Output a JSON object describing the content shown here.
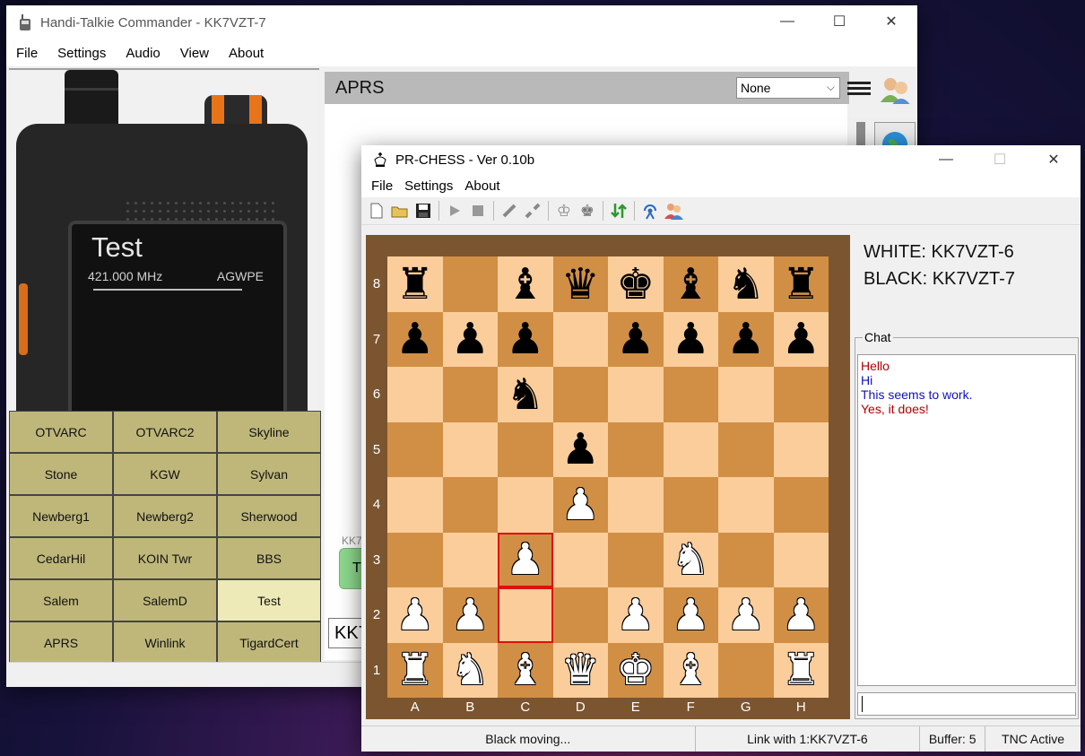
{
  "ht_window": {
    "title": "Handi-Talkie Commander - KK7VZT-7",
    "menu": [
      "File",
      "Settings",
      "Audio",
      "View",
      "About"
    ],
    "radio_screen": {
      "channel_name": "Test",
      "frequency": "421.000 MHz",
      "mode": "AGWPE"
    },
    "channels": [
      [
        "OTVARC",
        "OTVARC2",
        "Skyline"
      ],
      [
        "Stone",
        "KGW",
        "Sylvan"
      ],
      [
        "Newberg1",
        "Newberg2",
        "Sherwood"
      ],
      [
        "CedarHil",
        "KOIN Twr",
        "BBS"
      ],
      [
        "Salem",
        "SalemD",
        "Test"
      ],
      [
        "APRS",
        "Winlink",
        "TigardCert"
      ]
    ],
    "active_channel": "Test",
    "aprs": {
      "title": "APRS",
      "filter_value": "None"
    },
    "partial_label": "KK7",
    "partial_button": "T",
    "partial_input": "KK7"
  },
  "chess_window": {
    "title": "PR-CHESS - Ver 0.10b",
    "menu": [
      "File",
      "Settings",
      "About"
    ],
    "toolbar": [
      "new-icon",
      "open-icon",
      "save-icon",
      "play-icon",
      "stop-icon",
      "connect-icon",
      "disconnect-icon",
      "white-king-icon",
      "black-king-icon",
      "swap-icon",
      "antenna-icon",
      "users-icon"
    ],
    "white_player": "WHITE: KK7VZT-6",
    "black_player": "BLACK: KK7VZT-7",
    "board": [
      [
        "bR",
        "",
        "bB",
        "bQ",
        "bK",
        "bB",
        "bN",
        "bR"
      ],
      [
        "bP",
        "bP",
        "bP",
        "",
        "bP",
        "bP",
        "bP",
        "bP"
      ],
      [
        "",
        "",
        "bN",
        "",
        "",
        "",
        "",
        ""
      ],
      [
        "",
        "",
        "",
        "bP",
        "",
        "",
        "",
        ""
      ],
      [
        "",
        "",
        "",
        "wP",
        "",
        "",
        "",
        ""
      ],
      [
        "",
        "",
        "wP",
        "",
        "",
        "wN",
        "",
        ""
      ],
      [
        "wP",
        "wP",
        "",
        "",
        "wP",
        "wP",
        "wP",
        "wP"
      ],
      [
        "wR",
        "wN",
        "wB",
        "wQ",
        "wK",
        "wB",
        "",
        "wR"
      ]
    ],
    "highlighted_squares": [
      "c3",
      "c2"
    ],
    "files": [
      "A",
      "B",
      "C",
      "D",
      "E",
      "F",
      "G",
      "H"
    ],
    "ranks": [
      "8",
      "7",
      "6",
      "5",
      "4",
      "3",
      "2",
      "1"
    ],
    "chat": {
      "legend": "Chat",
      "lines": [
        {
          "text": "Hello",
          "color": "#b00000"
        },
        {
          "text": "Hi",
          "color": "#1010c0"
        },
        {
          "text": "This seems to work.",
          "color": "#1010c0"
        },
        {
          "text": "Yes, it does!",
          "color": "#b00000"
        }
      ],
      "input_value": ""
    },
    "status": {
      "state": "Black moving...",
      "link": "Link with 1:KK7VZT-6",
      "buffer": "Buffer: 5",
      "tnc": "TNC Active"
    }
  }
}
